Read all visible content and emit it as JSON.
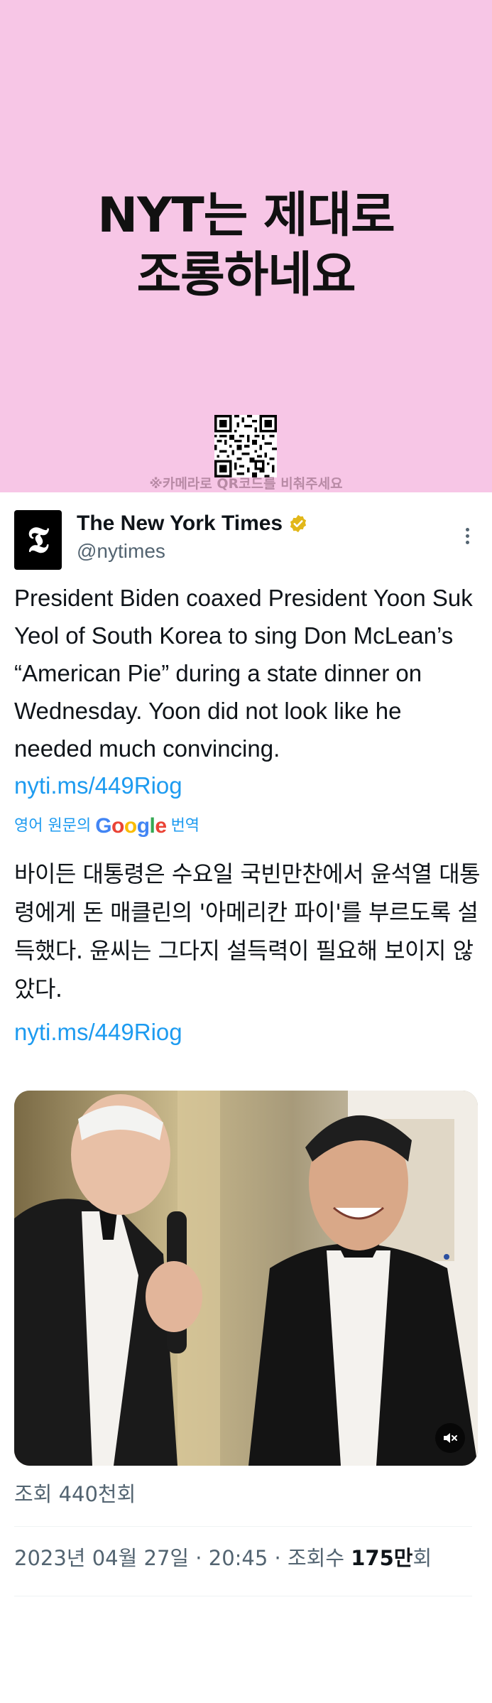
{
  "banner": {
    "title_line1": "NYT는 제대로",
    "title_line2": "조롱하네요",
    "qr_caption": "※카메라로 QR코드를 비춰주세요",
    "background_color": "#f7c6e6"
  },
  "tweet": {
    "author_name": "The New York Times",
    "author_handle": "@nytimes",
    "verified_badge_color": "#e2b719",
    "avatar_icon": "nyt-logo-icon",
    "more_icon": "more-vertical-icon",
    "text": "President Biden coaxed President Yoon Suk\nYeol of South Korea to sing Don McLean’s\n“American Pie” during a state dinner on\nWednesday. Yoon did not look like he\nneeded much convincing.",
    "link": "nyti.ms/449Riog",
    "translate_prefix": "영어 원문의",
    "translate_brand": "Google",
    "translate_suffix": "번역",
    "translated_text": "바이든 대통령은 수요일 국빈만찬에서 윤석열 대통령에게 돈 매클린의 '아메리칸 파이'를 부르도록 설득했다. 윤씨는 그다지 설득력이 필요해 보이지 않았다.",
    "translated_link": "nyti.ms/449Riog",
    "media_mute_icon": "mute-icon",
    "views_text": "조회 440천회",
    "timestamp": "2023년 04월 27일 · 20:45 · 조회수",
    "view_count_bold": "175만",
    "view_count_suffix": "회",
    "link_color": "#1d9bf0"
  }
}
